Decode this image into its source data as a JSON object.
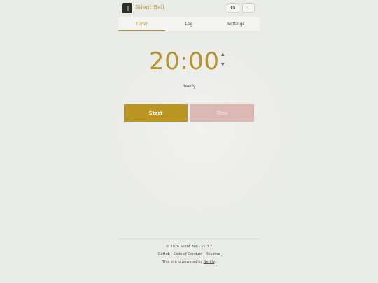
{
  "header": {
    "title": "Silent Bell",
    "lang_label": "EN",
    "theme_icon": "☾"
  },
  "tabs": [
    {
      "label": "Timer",
      "active": true
    },
    {
      "label": "Log",
      "active": false
    },
    {
      "label": "Settings",
      "active": false
    }
  ],
  "timer": {
    "display": "20:00",
    "up_symbol": "▲",
    "down_symbol": "▼",
    "status": "Ready"
  },
  "controls": {
    "start_label": "Start",
    "stop_label": "Stop"
  },
  "footer": {
    "copyright": "© 2026 Silent Bell · v1.3.2",
    "links": [
      "GitHub",
      "Code of Conduct",
      "Readme"
    ],
    "separator": " · ",
    "powered_prefix": "This site is powered by ",
    "powered_link": "Netlify",
    "powered_suffix": "."
  },
  "colors": {
    "accent": "#b8932e",
    "start_button": "#bb9522",
    "stop_button": "#dcb8b5",
    "background": "#e9ebe7"
  }
}
